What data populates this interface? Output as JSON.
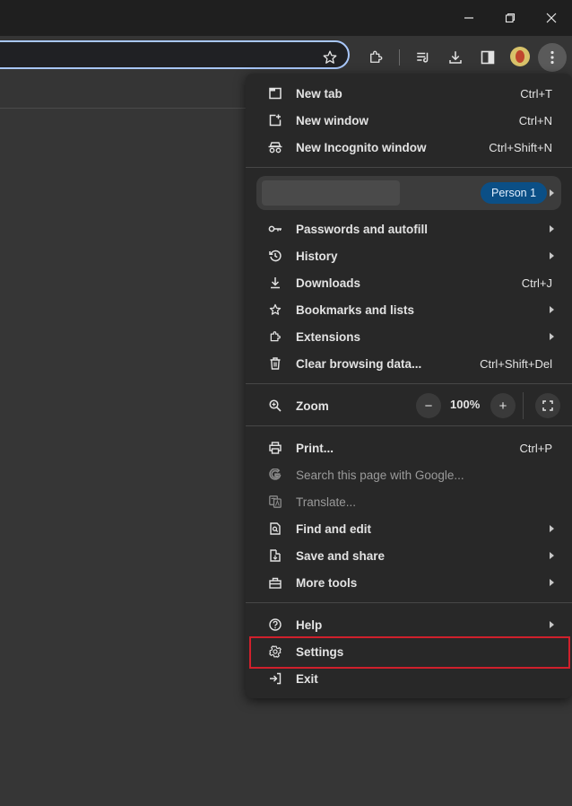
{
  "window": {
    "minimize_icon": "minimize-icon",
    "restore_icon": "restore-icon",
    "close_icon": "close-icon"
  },
  "toolbar": {
    "icons": [
      "star-icon",
      "extensions-icon",
      "reading-list-icon",
      "download-icon",
      "side-panel-icon",
      "avatar",
      "more-vert-icon"
    ]
  },
  "menu": {
    "group1": [
      {
        "label": "New tab",
        "shortcut": "Ctrl+T",
        "icon": "new-tab-icon"
      },
      {
        "label": "New window",
        "shortcut": "Ctrl+N",
        "icon": "new-window-icon"
      },
      {
        "label": "New Incognito window",
        "shortcut": "Ctrl+Shift+N",
        "icon": "incognito-icon"
      }
    ],
    "profile": {
      "badge": "Person 1"
    },
    "group2": [
      {
        "label": "Passwords and autofill",
        "icon": "key-icon"
      },
      {
        "label": "History",
        "icon": "history-icon"
      },
      {
        "label": "Downloads",
        "shortcut": "Ctrl+J",
        "icon": "download-icon"
      },
      {
        "label": "Bookmarks and lists",
        "icon": "star-icon"
      },
      {
        "label": "Extensions",
        "icon": "extensions-icon"
      },
      {
        "label": "Clear browsing data...",
        "shortcut": "Ctrl+Shift+Del",
        "icon": "trash-icon"
      }
    ],
    "zoom": {
      "label": "Zoom",
      "minus": "−",
      "value": "100%",
      "plus": "+"
    },
    "group3": [
      {
        "label": "Print...",
        "shortcut": "Ctrl+P",
        "icon": "print-icon"
      },
      {
        "label": "Search this page with Google...",
        "icon": "google-icon",
        "disabled": true
      },
      {
        "label": "Translate...",
        "icon": "translate-icon",
        "disabled": true
      },
      {
        "label": "Find and edit",
        "icon": "find-icon"
      },
      {
        "label": "Save and share",
        "icon": "save-share-icon"
      },
      {
        "label": "More tools",
        "icon": "toolbox-icon"
      }
    ],
    "group4": [
      {
        "label": "Help",
        "icon": "help-icon"
      },
      {
        "label": "Settings",
        "icon": "gear-icon"
      },
      {
        "label": "Exit",
        "icon": "exit-icon"
      }
    ]
  },
  "colors": {
    "highlight_border": "#d0202c",
    "profile_badge": "#0b4f86",
    "omnibox_focus": "#a8c7fa"
  }
}
